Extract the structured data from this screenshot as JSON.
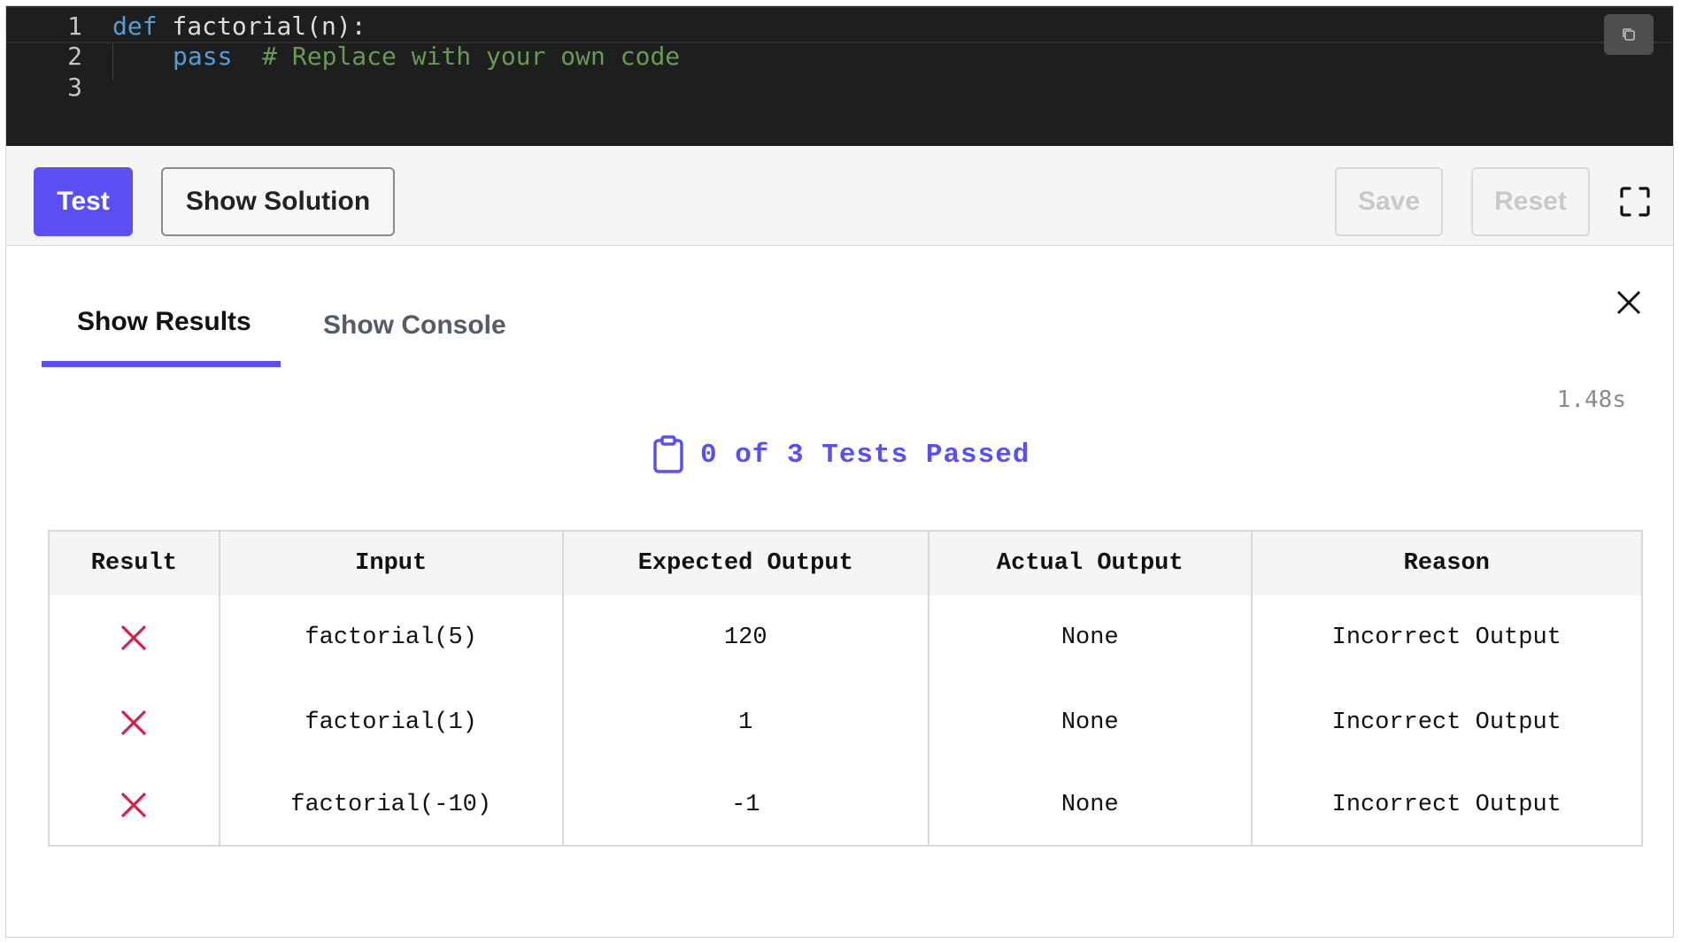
{
  "editor": {
    "lines": [
      {
        "number": "1",
        "keyword": "def",
        "text": " factorial(n):"
      },
      {
        "number": "2",
        "keyword": "pass",
        "comment": "# Replace with your own code"
      },
      {
        "number": "3"
      }
    ],
    "copy_icon": "copy-icon"
  },
  "toolbar": {
    "test_label": "Test",
    "show_solution_label": "Show Solution",
    "save_label": "Save",
    "reset_label": "Reset",
    "fullscreen_icon": "fullscreen-icon"
  },
  "results": {
    "tabs": [
      {
        "label": "Show Results",
        "active": true
      },
      {
        "label": "Show Console",
        "active": false
      }
    ],
    "close_icon": "close-icon",
    "elapsed": "1.48s",
    "summary": "0 of 3 Tests Passed",
    "summary_icon": "clipboard-icon",
    "table": {
      "headers": [
        "Result",
        "Input",
        "Expected Output",
        "Actual Output",
        "Reason"
      ],
      "rows": [
        {
          "result_icon": "fail-x-icon",
          "input": "factorial(5)",
          "expected": "120",
          "actual": "None",
          "reason": "Incorrect Output"
        },
        {
          "result_icon": "fail-x-icon",
          "input": "factorial(1)",
          "expected": "1",
          "actual": "None",
          "reason": "Incorrect Output"
        },
        {
          "result_icon": "fail-x-icon",
          "input": "factorial(-10)",
          "expected": "-1",
          "actual": "None",
          "reason": "Incorrect Output"
        }
      ]
    }
  },
  "colors": {
    "accent": "#5a4ff4",
    "fail": "#d6204a",
    "editor_bg": "#1e1e1e"
  }
}
